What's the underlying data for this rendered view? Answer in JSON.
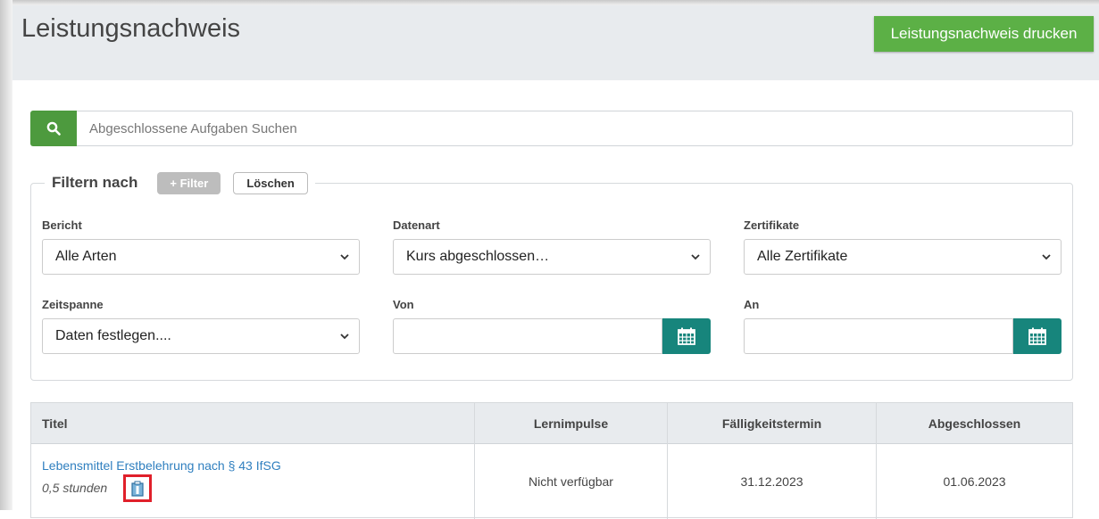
{
  "header": {
    "title": "Leistungsnachweis",
    "print_button": "Leistungsnachweis drucken"
  },
  "search": {
    "icon": "search-icon",
    "placeholder": "Abgeschlossene Aufgaben Suchen"
  },
  "filter": {
    "title": "Filtern nach",
    "add_filter_button": "+ Filter",
    "clear_button": "Löschen",
    "fields": {
      "bericht": {
        "label": "Bericht",
        "value": "Alle Arten"
      },
      "datenart": {
        "label": "Datenart",
        "value": "Kurs abgeschlossen…"
      },
      "zertifikate": {
        "label": "Zertifikate",
        "value": "Alle Zertifikate"
      },
      "zeitspanne": {
        "label": "Zeitspanne",
        "value": "Daten festlegen...."
      },
      "von": {
        "label": "Von",
        "value": ""
      },
      "an": {
        "label": "An",
        "value": ""
      }
    }
  },
  "table": {
    "columns": [
      "Titel",
      "Lernimpulse",
      "Fälligkeitstermin",
      "Abgeschlossen"
    ],
    "rows": [
      {
        "title": "Lebensmittel Erstbelehrung nach § 43 IfSG",
        "hours": "0,5 stunden",
        "lernimpulse": "Nicht verfügbar",
        "due": "31.12.2023",
        "completed": "01.06.2023"
      }
    ]
  },
  "colors": {
    "print_button": "#5cb046",
    "search_button": "#4d9a3e",
    "calendar_button": "#17857c",
    "link": "#2f7fbf",
    "highlight_box": "#e0202a"
  }
}
